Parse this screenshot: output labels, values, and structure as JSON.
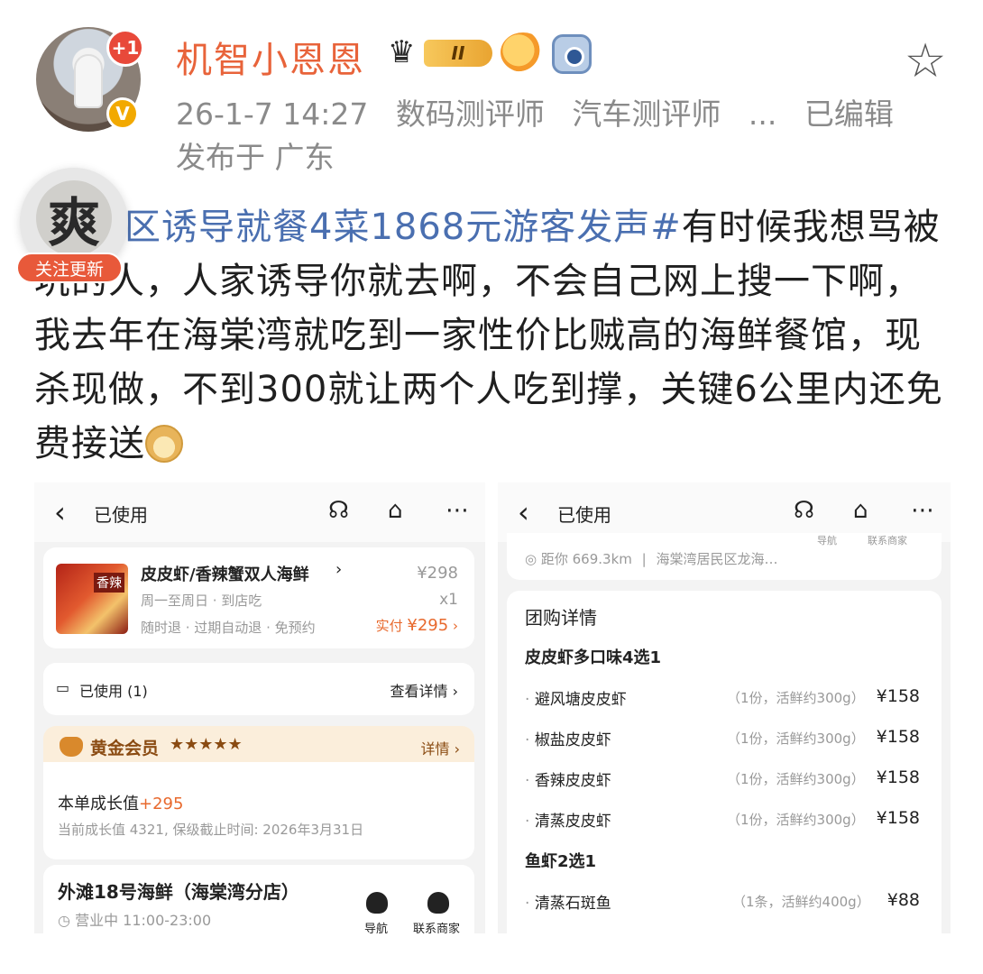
{
  "header": {
    "avatar_badge": "+1",
    "verified_badge": "V",
    "username": "机智小恩恩",
    "level_badge": "II",
    "timestamp": "26-1-7 14:27",
    "tags": [
      "数码测评师",
      "汽车测评师",
      "...",
      "已编辑"
    ],
    "location": "发布于 广东"
  },
  "follow": {
    "avatar_char": "爽",
    "label": "关注更新"
  },
  "post": {
    "hashtag": "#景区诱导就餐4菜1868元游客发声#",
    "hashtag_visible": "区诱导就餐4菜1868元游客发声#",
    "body": "有时候我想骂被坑的人，人家诱导你就去啊，不会自己网上搜一下啊，我去年在海棠湾就吃到一家性价比贼高的海鲜餐馆，现杀现做，不到300就让两个人吃到撑，关键6公里内还免费接送"
  },
  "left_panel": {
    "title": "已使用",
    "order": {
      "name": "皮皮虾/香辣蟹双人海鲜",
      "price": "¥298",
      "days": "周一至周日 · 到店吃",
      "qty": "x1",
      "policy": "随时退 · 过期自动退 · 免预约",
      "paid_label": "实付",
      "paid": "¥295",
      "img_label": "香辣"
    },
    "used": {
      "label": "已使用 (1)",
      "detail": "查看详情"
    },
    "member": {
      "title": "黄金会员",
      "stars": "★★★★★",
      "detail": "详情",
      "growth_label": "本单成长值",
      "growth_value": "+295",
      "note": "当前成长值 4321, 保级截止时间: 2026年3月31日"
    },
    "shop": {
      "name": "外滩18号海鲜（海棠湾分店）",
      "hours": "营业中 11:00-23:00",
      "nav": "导航",
      "contact": "联系商家"
    }
  },
  "right_panel": {
    "title": "已使用",
    "top_hint_nav": "导航",
    "top_hint_contact": "联系商家",
    "distance": "距你 669.3km",
    "address": "海棠湾居民区龙海…",
    "section_title": "团购详情",
    "groups": [
      {
        "title": "皮皮虾多口味4选1",
        "items": [
          {
            "name": "避风塘皮皮虾",
            "spec": "（1份，活鲜约300g）",
            "price": "¥158"
          },
          {
            "name": "椒盐皮皮虾",
            "spec": "（1份，活鲜约300g）",
            "price": "¥158"
          },
          {
            "name": "香辣皮皮虾",
            "spec": "（1份，活鲜约300g）",
            "price": "¥158"
          },
          {
            "name": "清蒸皮皮虾",
            "spec": "（1份，活鲜约300g）",
            "price": "¥158"
          }
        ]
      },
      {
        "title": "鱼虾2选1",
        "items": [
          {
            "name": "清蒸石斑鱼",
            "spec": "（1条，活鲜约400g）",
            "price": "¥88"
          }
        ]
      }
    ]
  }
}
